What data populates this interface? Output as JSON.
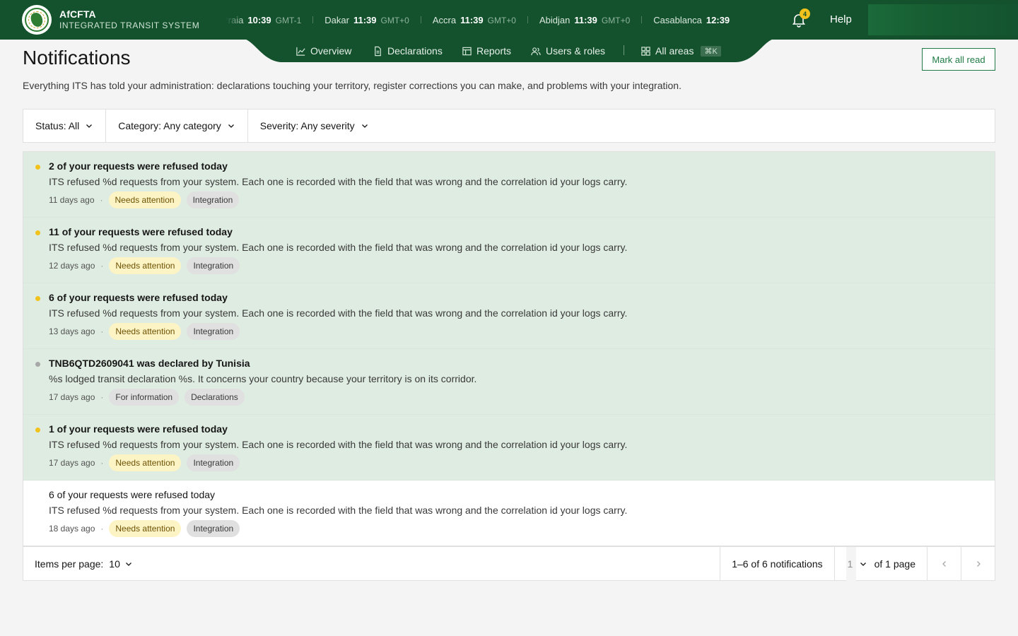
{
  "header": {
    "brand_name": "AfCFTA",
    "brand_sub": "INTEGRATED TRANSIT SYSTEM",
    "clocks": [
      {
        "city": "Praia",
        "time": "10:39",
        "tz": "GMT-1"
      },
      {
        "city": "Dakar",
        "time": "11:39",
        "tz": "GMT+0"
      },
      {
        "city": "Accra",
        "time": "11:39",
        "tz": "GMT+0"
      },
      {
        "city": "Abidjan",
        "time": "11:39",
        "tz": "GMT+0"
      },
      {
        "city": "Casablanca",
        "time": "12:39",
        "tz": ""
      }
    ],
    "notification_count": "4",
    "help_label": "Help"
  },
  "nav": {
    "items": [
      {
        "label": "Overview",
        "icon": "chart-line-icon"
      },
      {
        "label": "Declarations",
        "icon": "document-icon"
      },
      {
        "label": "Reports",
        "icon": "table-icon"
      },
      {
        "label": "Users & roles",
        "icon": "users-icon"
      },
      {
        "label": "All areas",
        "icon": "grid-icon"
      }
    ],
    "shortcut": "⌘K"
  },
  "page": {
    "title": "Notifications",
    "description": "Everything ITS has told your administration: declarations touching your territory, register corrections you can make, and problems with your integration.",
    "mark_all_read": "Mark all read"
  },
  "filters": {
    "status": "Status: All",
    "category": "Category: Any category",
    "severity": "Severity: Any severity"
  },
  "notifications": [
    {
      "title": "2 of your requests were refused today",
      "body": "ITS refused %d requests from your system. Each one is recorded with the field that was wrong and the correlation id your logs carry.",
      "time": "11 days ago",
      "severity": "Needs attention",
      "category": "Integration",
      "unread": true,
      "dot_color": "#f1c21b"
    },
    {
      "title": "11 of your requests were refused today",
      "body": "ITS refused %d requests from your system. Each one is recorded with the field that was wrong and the correlation id your logs carry.",
      "time": "12 days ago",
      "severity": "Needs attention",
      "category": "Integration",
      "unread": true,
      "dot_color": "#f1c21b"
    },
    {
      "title": "6 of your requests were refused today",
      "body": "ITS refused %d requests from your system. Each one is recorded with the field that was wrong and the correlation id your logs carry.",
      "time": "13 days ago",
      "severity": "Needs attention",
      "category": "Integration",
      "unread": true,
      "dot_color": "#f1c21b"
    },
    {
      "title": "TNB6QTD2609041 was declared by Tunisia",
      "body": "%s lodged transit declaration %s. It concerns your country because your territory is on its corridor.",
      "time": "17 days ago",
      "severity": "For information",
      "category": "Declarations",
      "unread": true,
      "dot_color": "#a8a8a8"
    },
    {
      "title": "1 of your requests were refused today",
      "body": "ITS refused %d requests from your system. Each one is recorded with the field that was wrong and the correlation id your logs carry.",
      "time": "17 days ago",
      "severity": "Needs attention",
      "category": "Integration",
      "unread": true,
      "dot_color": "#f1c21b"
    },
    {
      "title": "6 of your requests were refused today",
      "body": "ITS refused %d requests from your system. Each one is recorded with the field that was wrong and the correlation id your logs carry.",
      "time": "18 days ago",
      "severity": "Needs attention",
      "category": "Integration",
      "unread": false,
      "dot_color": ""
    }
  ],
  "pager": {
    "items_per_page_label": "Items per page:",
    "items_per_page": "10",
    "range": "1–6 of 6 notifications",
    "page": "1",
    "of_pages": "of 1 page"
  },
  "colors": {
    "brand": "#13522d",
    "accent": "#1f7a45",
    "unread_row": "#dfece2",
    "warning_dot": "#f1c21b"
  }
}
